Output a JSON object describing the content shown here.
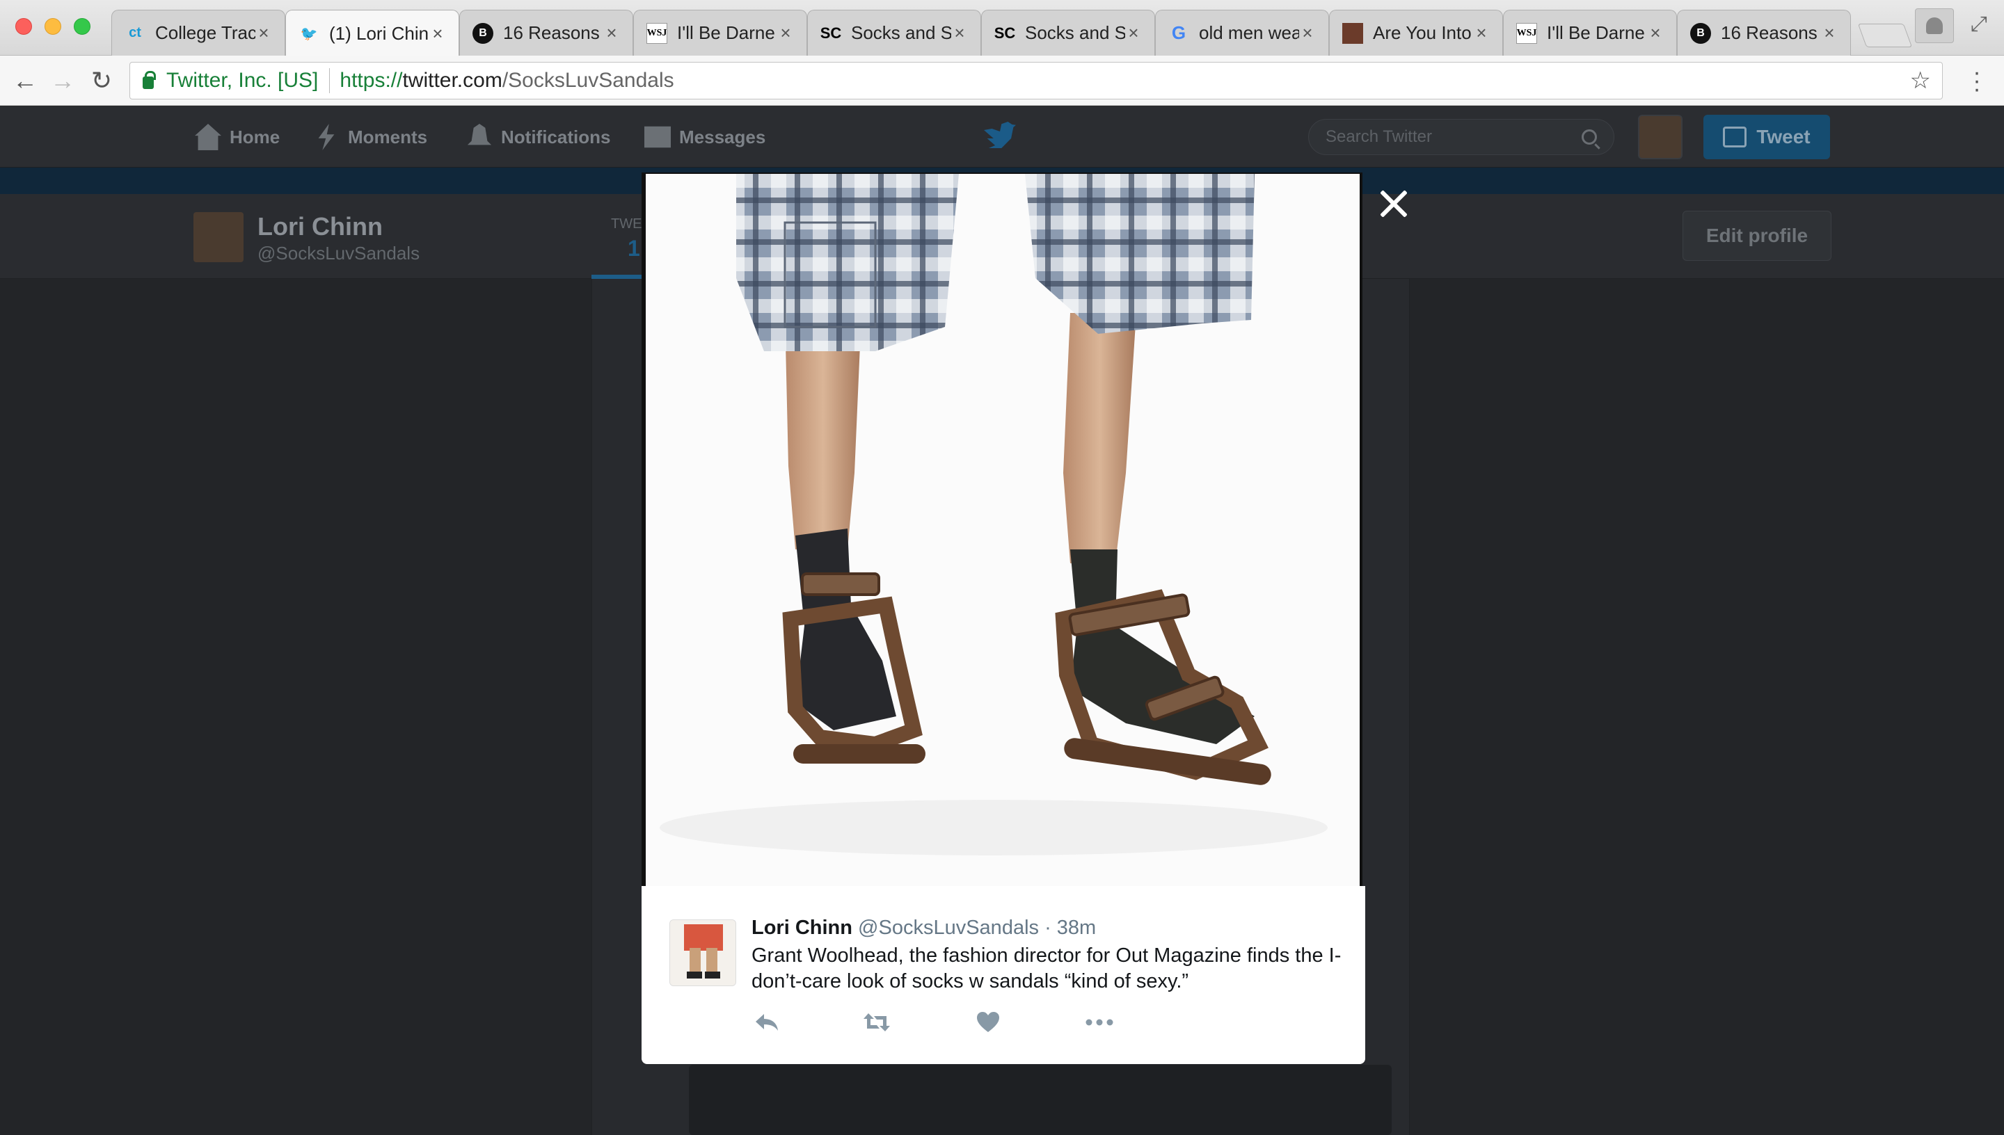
{
  "browser": {
    "tabs": [
      {
        "icon": "college-tracks-favicon",
        "title": "College Trac",
        "active": false
      },
      {
        "icon": "twitter-bird-favicon",
        "title": "(1) Lori Chin",
        "active": true
      },
      {
        "icon": "bustle-favicon",
        "title": "16 Reasons",
        "active": false
      },
      {
        "icon": "wsj-favicon",
        "title": "I'll Be Darne",
        "active": false
      },
      {
        "icon": "sc-favicon",
        "title": "Socks and Sa",
        "active": false
      },
      {
        "icon": "sc-favicon",
        "title": "Socks and Sa",
        "active": false
      },
      {
        "icon": "google-favicon",
        "title": "old men wea",
        "active": false
      },
      {
        "icon": "image-favicon",
        "title": "Are You Into",
        "active": false
      },
      {
        "icon": "wsj-favicon",
        "title": "I'll Be Darne",
        "active": false
      },
      {
        "icon": "bustle-favicon",
        "title": "16 Reasons",
        "active": false
      }
    ],
    "address": {
      "org": "Twitter, Inc. [US]",
      "scheme": "https://",
      "host": "twitter.com",
      "path": "/SocksLuvSandals"
    }
  },
  "twitter": {
    "nav": {
      "home": "Home",
      "moments": "Moments",
      "notifications": "Notifications",
      "messages": "Messages"
    },
    "search_placeholder": "Search Twitter",
    "tweet_button": "Tweet",
    "profile": {
      "name": "Lori Chinn",
      "handle": "@SocksLuvSandals",
      "stats_label": "TWE",
      "stats_value": "1"
    },
    "edit_profile": "Edit profile"
  },
  "lightbox": {
    "author_name": "Lori Chinn",
    "author_handle": "@SocksLuvSandals",
    "timestamp": "· 38m",
    "text": "Grant Woolhead, the fashion director for Out Magazine finds the I-don’t-care look of socks w sandals “kind of sexy.”",
    "actions": [
      "reply-icon",
      "retweet-icon",
      "like-icon",
      "more-icon"
    ],
    "colors": {
      "text": "#14171a",
      "meta": "#657786",
      "action": "#8899a6"
    }
  }
}
